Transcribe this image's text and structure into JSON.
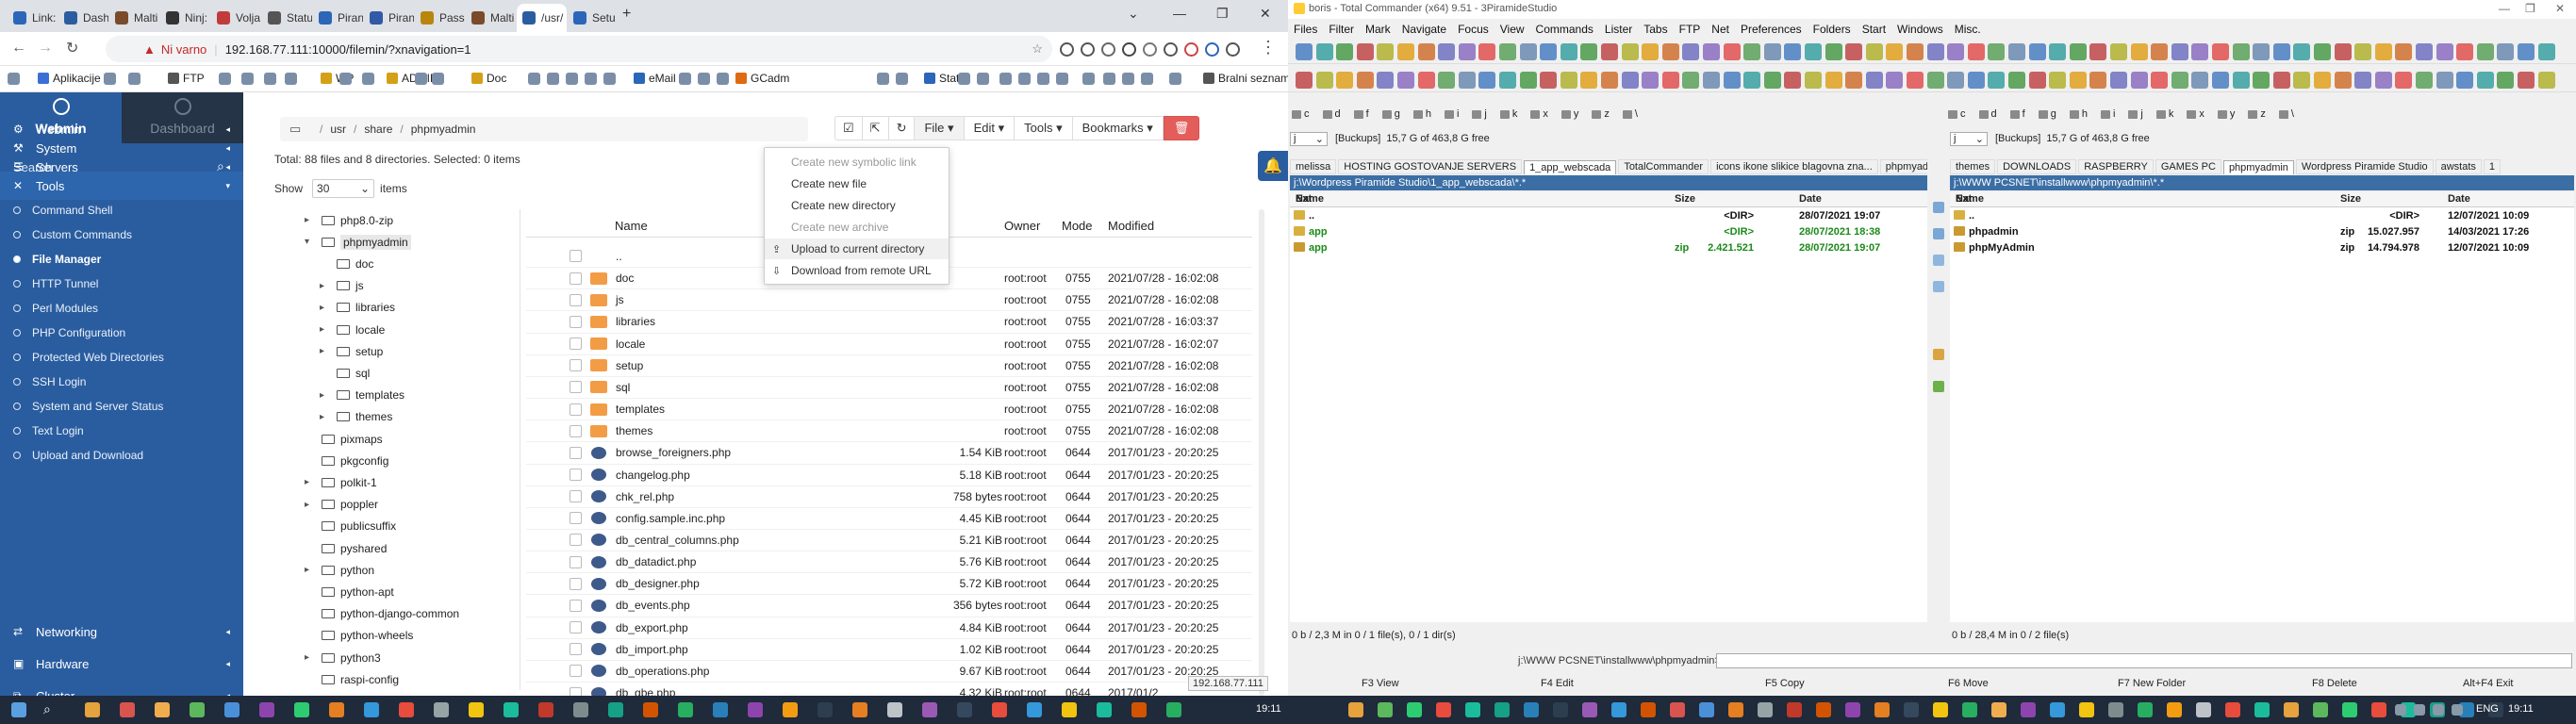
{
  "chrome": {
    "tabs": [
      {
        "label": "Link:",
        "color": "#2b66b8"
      },
      {
        "label": "Dash",
        "color": "#2a5d9f"
      },
      {
        "label": "Malti",
        "color": "#7a4b2a"
      },
      {
        "label": "Ninj:",
        "color": "#333333"
      },
      {
        "label": "Volja",
        "color": "#c23b3b"
      },
      {
        "label": "Statu",
        "color": "#555555"
      },
      {
        "label": "Piran",
        "color": "#2b66b8"
      },
      {
        "label": "Piran",
        "color": "#3059a8"
      },
      {
        "label": "Pass",
        "color": "#b8860b"
      },
      {
        "label": "Malti",
        "color": "#7a4b2a"
      },
      {
        "label": "/usr/",
        "color": "#2a5d9f"
      },
      {
        "label": "Setu",
        "color": "#2b66b8"
      }
    ],
    "address": {
      "security": "Ni varno",
      "url": "192.168.77.111:10000/filemin/?xnavigation=1"
    },
    "bookmarks": [
      "Aplikacije",
      "FTP",
      "WP",
      "ADMIN",
      "Doc",
      "eMail",
      "GCadm",
      "Stats",
      "Bralni seznam"
    ]
  },
  "webmin": {
    "brand": "Webmin",
    "dashboard": "Dashboard",
    "search_placeholder": "Search",
    "menu": [
      {
        "label": "Webmin",
        "icon": "gear-icon"
      },
      {
        "label": "System",
        "icon": "wrench-icon"
      },
      {
        "label": "Servers",
        "icon": "server-icon"
      },
      {
        "label": "Tools",
        "icon": "tools-icon"
      }
    ],
    "tools_items": [
      "Command Shell",
      "Custom Commands",
      "File Manager",
      "HTTP Tunnel",
      "Perl Modules",
      "PHP Configuration",
      "Protected Web Directories",
      "SSH Login",
      "System and Server Status",
      "Text Login",
      "Upload and Download"
    ],
    "menu_bottom": [
      {
        "label": "Networking",
        "icon": "network-icon"
      },
      {
        "label": "Hardware",
        "icon": "hardware-icon"
      },
      {
        "label": "Cluster",
        "icon": "cluster-icon"
      }
    ],
    "active_item": "File Manager"
  },
  "filemanager": {
    "breadcrumb": [
      "usr",
      "share",
      "phpmyadmin"
    ],
    "toolbar": {
      "file": "File",
      "edit": "Edit",
      "tools": "Tools",
      "bookmarks": "Bookmarks"
    },
    "dropdown": [
      {
        "label": "Create new symbolic link",
        "enabled": false
      },
      {
        "label": "Create new file",
        "enabled": true
      },
      {
        "label": "Create new directory",
        "enabled": true
      },
      {
        "label": "Create new archive",
        "enabled": false
      },
      {
        "label": "Upload to current directory",
        "enabled": true
      },
      {
        "label": "Download from remote URL",
        "enabled": true
      }
    ],
    "summary": "Total: 88 files and 8 directories. Selected: 0 items",
    "show_label": "Show",
    "show_value": "30",
    "items_label": "items",
    "columns": [
      "Name",
      "Owner",
      "Mode",
      "Modified"
    ],
    "tree": [
      {
        "name": "php8.0-zip",
        "indent": 0,
        "caret": "▸"
      },
      {
        "name": "phpmyadmin",
        "indent": 0,
        "caret": "▾"
      },
      {
        "name": "doc",
        "indent": 1,
        "caret": ""
      },
      {
        "name": "js",
        "indent": 1,
        "caret": "▸"
      },
      {
        "name": "libraries",
        "indent": 1,
        "caret": "▸"
      },
      {
        "name": "locale",
        "indent": 1,
        "caret": "▸"
      },
      {
        "name": "setup",
        "indent": 1,
        "caret": "▸"
      },
      {
        "name": "sql",
        "indent": 1,
        "caret": ""
      },
      {
        "name": "templates",
        "indent": 1,
        "caret": "▸"
      },
      {
        "name": "themes",
        "indent": 1,
        "caret": "▸"
      },
      {
        "name": "pixmaps",
        "indent": 0,
        "caret": ""
      },
      {
        "name": "pkgconfig",
        "indent": 0,
        "caret": ""
      },
      {
        "name": "polkit-1",
        "indent": 0,
        "caret": "▸"
      },
      {
        "name": "poppler",
        "indent": 0,
        "caret": "▸"
      },
      {
        "name": "publicsuffix",
        "indent": 0,
        "caret": ""
      },
      {
        "name": "pyshared",
        "indent": 0,
        "caret": ""
      },
      {
        "name": "python",
        "indent": 0,
        "caret": "▸"
      },
      {
        "name": "python-apt",
        "indent": 0,
        "caret": ""
      },
      {
        "name": "python-django-common",
        "indent": 0,
        "caret": ""
      },
      {
        "name": "python-wheels",
        "indent": 0,
        "caret": ""
      },
      {
        "name": "python3",
        "indent": 0,
        "caret": "▸"
      },
      {
        "name": "raspi-config",
        "indent": 0,
        "caret": ""
      }
    ],
    "rows": [
      {
        "name": "..",
        "size": "",
        "owner": "",
        "mode": "",
        "modified": "",
        "type": "up"
      },
      {
        "name": "doc",
        "size": "",
        "owner": "root:root",
        "mode": "0755",
        "modified": "2021/07/28 - 16:02:08",
        "type": "dir"
      },
      {
        "name": "js",
        "size": "",
        "owner": "root:root",
        "mode": "0755",
        "modified": "2021/07/28 - 16:02:08",
        "type": "dir"
      },
      {
        "name": "libraries",
        "size": "",
        "owner": "root:root",
        "mode": "0755",
        "modified": "2021/07/28 - 16:03:37",
        "type": "dir"
      },
      {
        "name": "locale",
        "size": "",
        "owner": "root:root",
        "mode": "0755",
        "modified": "2021/07/28 - 16:02:07",
        "type": "dir"
      },
      {
        "name": "setup",
        "size": "",
        "owner": "root:root",
        "mode": "0755",
        "modified": "2021/07/28 - 16:02:08",
        "type": "dir"
      },
      {
        "name": "sql",
        "size": "",
        "owner": "root:root",
        "mode": "0755",
        "modified": "2021/07/28 - 16:02:08",
        "type": "dir"
      },
      {
        "name": "templates",
        "size": "",
        "owner": "root:root",
        "mode": "0755",
        "modified": "2021/07/28 - 16:02:08",
        "type": "dir"
      },
      {
        "name": "themes",
        "size": "",
        "owner": "root:root",
        "mode": "0755",
        "modified": "2021/07/28 - 16:02:08",
        "type": "dir"
      },
      {
        "name": "browse_foreigners.php",
        "size": "1.54 KiB",
        "owner": "root:root",
        "mode": "0644",
        "modified": "2017/01/23 - 20:20:25",
        "type": "file"
      },
      {
        "name": "changelog.php",
        "size": "5.18 KiB",
        "owner": "root:root",
        "mode": "0644",
        "modified": "2017/01/23 - 20:20:25",
        "type": "file"
      },
      {
        "name": "chk_rel.php",
        "size": "758 bytes",
        "owner": "root:root",
        "mode": "0644",
        "modified": "2017/01/23 - 20:20:25",
        "type": "file"
      },
      {
        "name": "config.sample.inc.php",
        "size": "4.45 KiB",
        "owner": "root:root",
        "mode": "0644",
        "modified": "2017/01/23 - 20:20:25",
        "type": "file"
      },
      {
        "name": "db_central_columns.php",
        "size": "5.21 KiB",
        "owner": "root:root",
        "mode": "0644",
        "modified": "2017/01/23 - 20:20:25",
        "type": "file"
      },
      {
        "name": "db_datadict.php",
        "size": "5.76 KiB",
        "owner": "root:root",
        "mode": "0644",
        "modified": "2017/01/23 - 20:20:25",
        "type": "file"
      },
      {
        "name": "db_designer.php",
        "size": "5.72 KiB",
        "owner": "root:root",
        "mode": "0644",
        "modified": "2017/01/23 - 20:20:25",
        "type": "file"
      },
      {
        "name": "db_events.php",
        "size": "356 bytes",
        "owner": "root:root",
        "mode": "0644",
        "modified": "2017/01/23 - 20:20:25",
        "type": "file"
      },
      {
        "name": "db_export.php",
        "size": "4.84 KiB",
        "owner": "root:root",
        "mode": "0644",
        "modified": "2017/01/23 - 20:20:25",
        "type": "file"
      },
      {
        "name": "db_import.php",
        "size": "1.02 KiB",
        "owner": "root:root",
        "mode": "0644",
        "modified": "2017/01/23 - 20:20:25",
        "type": "file"
      },
      {
        "name": "db_operations.php",
        "size": "9.67 KiB",
        "owner": "root:root",
        "mode": "0644",
        "modified": "2017/01/23 - 20:20:25",
        "type": "file"
      },
      {
        "name": "db_qbe.php",
        "size": "4.32 KiB",
        "owner": "root:root",
        "mode": "0644",
        "modified": "2017/01/2",
        "type": "file"
      }
    ],
    "status_url": "192.168.77.111"
  },
  "tc": {
    "title": "boris - Total Commander (x64) 9.51 - 3PiramideStudio",
    "menu": [
      "Files",
      "Filter",
      "Mark",
      "Navigate",
      "Focus",
      "View",
      "Commands",
      "Lister",
      "Tabs",
      "FTP",
      "Net",
      "Preferences",
      "Folders",
      "Start",
      "Windows",
      "Misc."
    ],
    "drive_labels": [
      "c",
      "d",
      "f",
      "g",
      "h",
      "i",
      "j",
      "k",
      "x",
      "y",
      "z",
      "\\"
    ],
    "left": {
      "drive": "j",
      "volume": "[Buckups]",
      "free": "15,7 G of 463,8 G free",
      "tabs": [
        "melissa",
        "HOSTING GOSTOVANJE SERVERS",
        "1_app_webscada",
        "TotalCommander",
        "icons ikone slikice blagovna zna...",
        "phpmyadr"
      ],
      "path": "j:\\Wordpress Piramide Studio\\1_app_webscada\\*.*",
      "columns": [
        "Name",
        "Ext",
        "Size",
        "Date"
      ],
      "rows": [
        {
          "name": "..",
          "ext": "",
          "size": "<DIR>",
          "date": "28/07/2021 19:07",
          "kind": "up"
        },
        {
          "name": "app",
          "ext": "",
          "size": "<DIR>",
          "date": "28/07/2021 18:38",
          "kind": "dir"
        },
        {
          "name": "app",
          "ext": "zip",
          "size": "2.421.521",
          "date": "28/07/2021 19:07",
          "kind": "file"
        }
      ],
      "status": "0 b / 2,3 M in 0 / 1 file(s), 0 / 1 dir(s)"
    },
    "right": {
      "drive": "j",
      "volume": "[Buckups]",
      "free": "15,7 G of 463,8 G free",
      "tabs": [
        "themes",
        "DOWNLOADS",
        "RASPBERRY",
        "GAMES PC",
        "phpmyadmin",
        "Wordpress Piramide Studio",
        "awstats",
        "1"
      ],
      "path": "j:\\WWW PCSNET\\installwww\\phpmyadmin\\*.*",
      "columns": [
        "Name",
        "Ext",
        "Size",
        "Date"
      ],
      "rows": [
        {
          "name": "..",
          "ext": "",
          "size": "<DIR>",
          "date": "12/07/2021 10:09",
          "kind": "up"
        },
        {
          "name": "phpadmin",
          "ext": "zip",
          "size": "15.027.957",
          "date": "14/03/2021 17:26",
          "kind": "file"
        },
        {
          "name": "phpMyAdmin",
          "ext": "zip",
          "size": "14.794.978",
          "date": "12/07/2021 10:09",
          "kind": "file"
        }
      ],
      "status": "0 b / 28,4 M in 0 / 2 file(s)"
    },
    "cmd_path": "j:\\WWW PCSNET\\installwww\\phpmyadmin>",
    "fkeys": [
      "F3 View",
      "F4 Edit",
      "F5 Copy",
      "F6 Move",
      "F7 New Folder",
      "F8 Delete",
      "Alt+F4 Exit"
    ]
  },
  "taskbar": {
    "time_left": "19:11",
    "time_right": "19:11",
    "lang": "ENG"
  }
}
